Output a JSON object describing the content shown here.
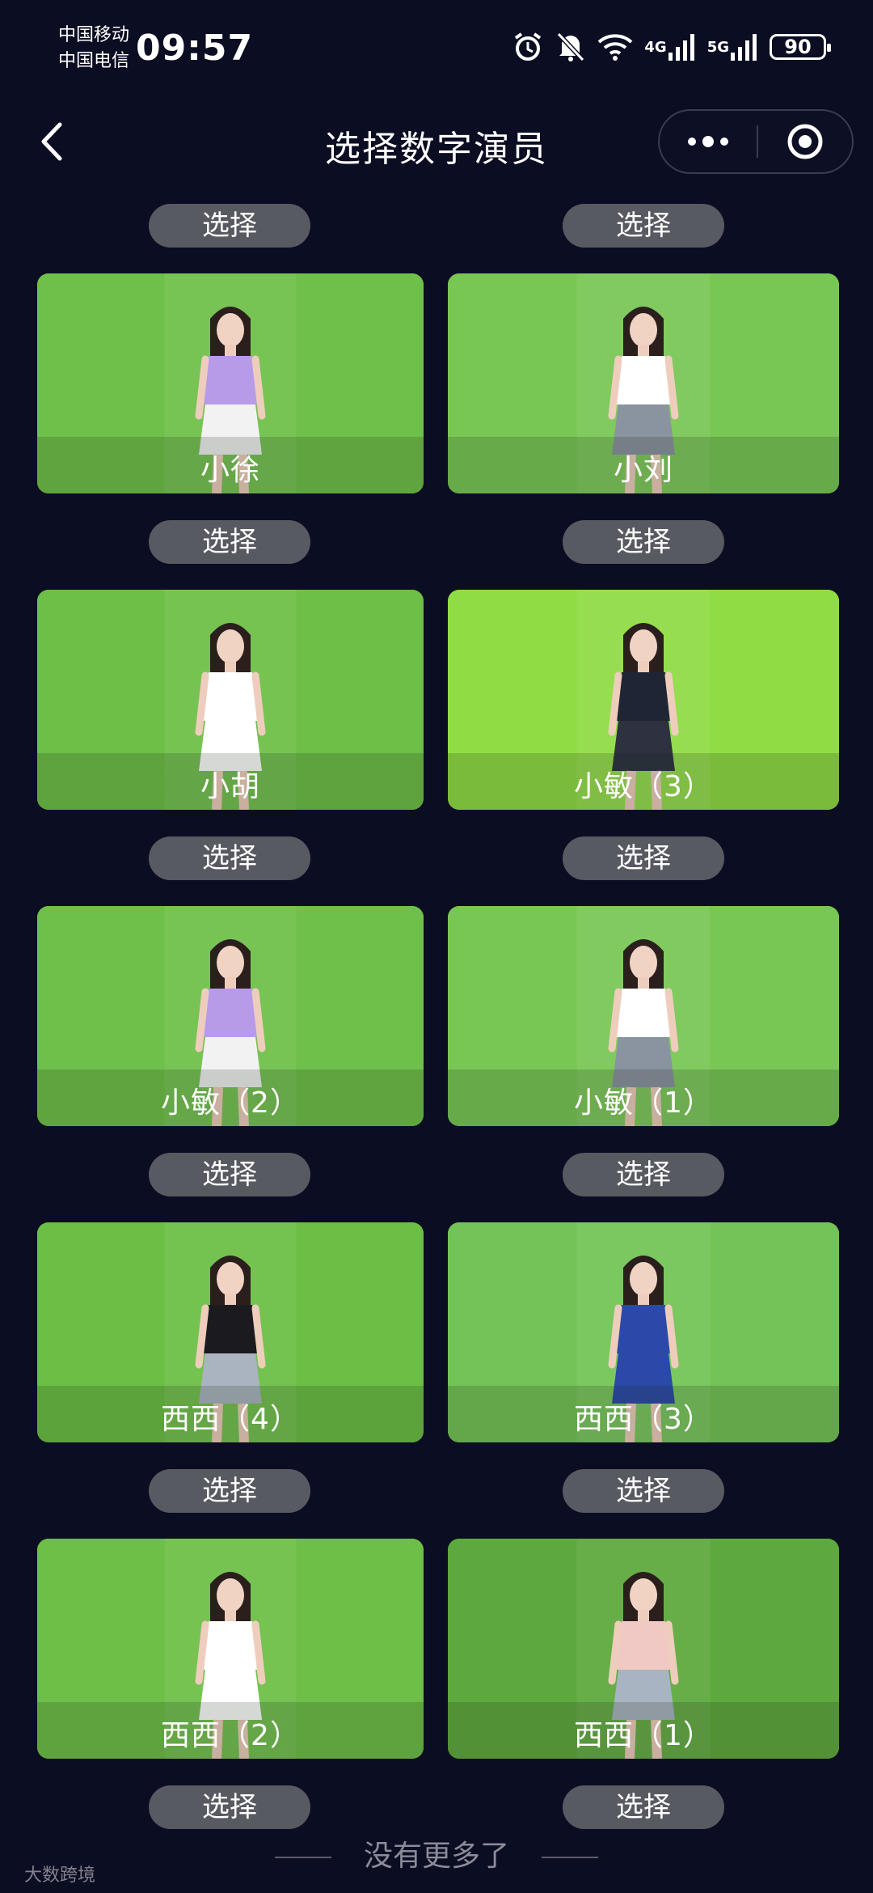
{
  "status_bar": {
    "carrier1": "中国移动",
    "carrier2": "中国电信",
    "time": "09:57",
    "net1": "4G",
    "net2": "5G",
    "battery": "90"
  },
  "nav": {
    "title": "选择数字演员"
  },
  "select_label": "选择",
  "actors": [
    {
      "name": "小徐",
      "bg": "#6fc04a",
      "top": "#b79be8",
      "bottom": "#f2f2f2"
    },
    {
      "name": "小刘",
      "bg": "#78c755",
      "top": "#ffffff",
      "bottom": "#8a93a0"
    },
    {
      "name": "小胡",
      "bg": "#6dbf47",
      "top": "#ffffff",
      "bottom": "#ffffff"
    },
    {
      "name": "小敏（3）",
      "bg": "#8fdc44",
      "top": "#1e2636",
      "bottom": "#2d3140"
    },
    {
      "name": "小敏（2）",
      "bg": "#6fc04a",
      "top": "#b79be8",
      "bottom": "#f2f2f2"
    },
    {
      "name": "小敏（1）",
      "bg": "#78c755",
      "top": "#ffffff",
      "bottom": "#8a93a0"
    },
    {
      "name": "西西（4）",
      "bg": "#6bbf45",
      "top": "#1b1b1f",
      "bottom": "#aab4c0"
    },
    {
      "name": "西西（3）",
      "bg": "#73c456",
      "top": "#2b49a8",
      "bottom": "#2b49a8"
    },
    {
      "name": "西西（2）",
      "bg": "#6dbf47",
      "top": "#ffffff",
      "bottom": "#ffffff"
    },
    {
      "name": "西西（1）",
      "bg": "#5ea93d",
      "top": "#f0c9c5",
      "bottom": "#a9b4c2"
    }
  ],
  "footer": "没有更多了",
  "watermark": "大数跨境"
}
